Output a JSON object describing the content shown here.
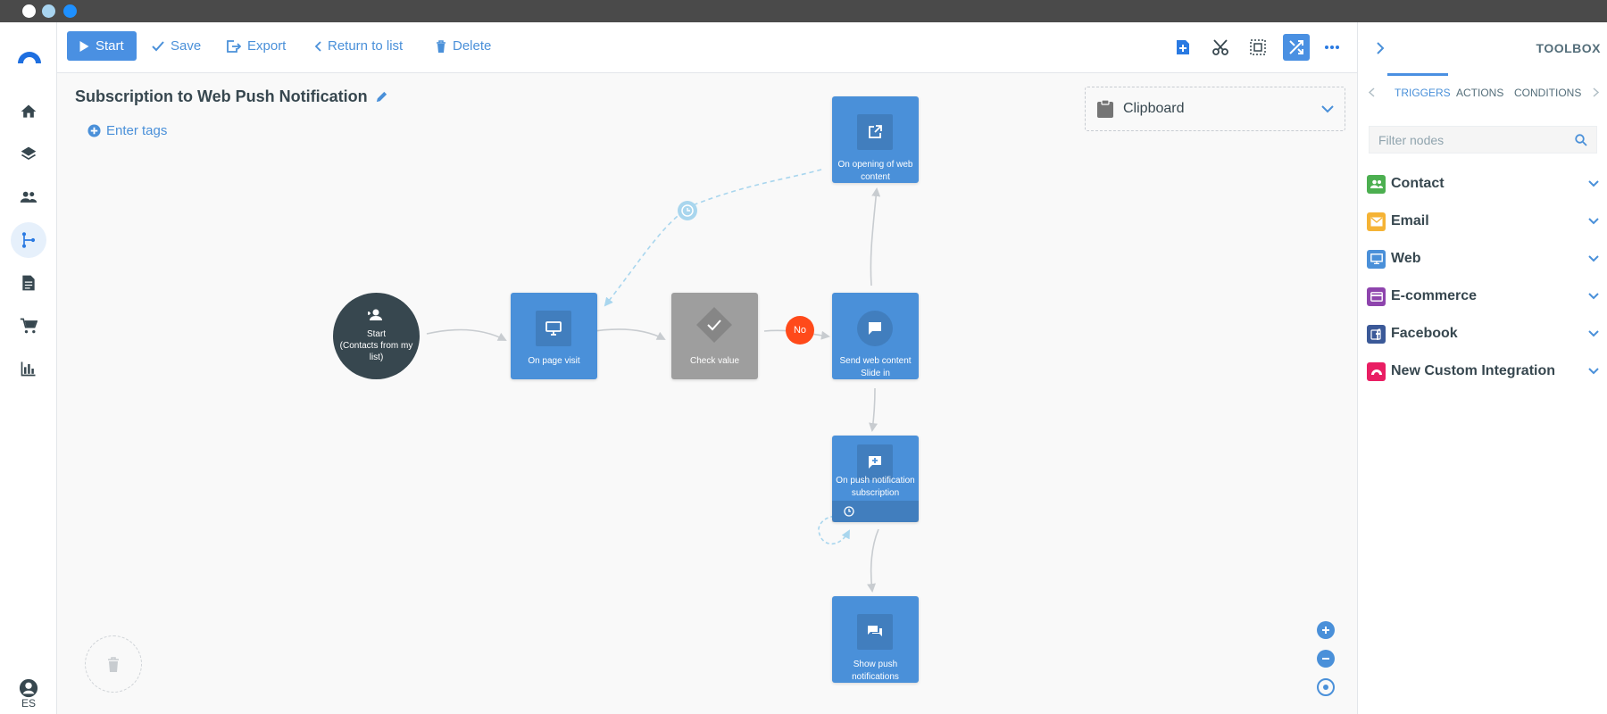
{
  "window": {
    "dots": [
      "#ffffff",
      "#a8d4f0",
      "#1e90ff"
    ]
  },
  "toolbar": {
    "start_label": "Start",
    "save_label": "Save",
    "export_label": "Export",
    "return_label": "Return to list",
    "delete_label": "Delete",
    "icons": [
      "add-note-icon",
      "scissors-icon",
      "select-icon",
      "shuffle-icon",
      "more-icon"
    ]
  },
  "rail": {
    "items": [
      "home",
      "layers",
      "contacts",
      "flows",
      "documents",
      "cart",
      "reports"
    ],
    "active": "flows",
    "lang": "ES"
  },
  "canvas": {
    "title": "Subscription to Web Push Notification",
    "tags_label": "Enter tags",
    "clipboard_label": "Clipboard",
    "nodes": {
      "start": {
        "line1": "Start",
        "line2": "(Contacts from my list)"
      },
      "page_visit": "On page visit",
      "check_value": "Check value",
      "no_badge": "No",
      "send_web": "Send web content Slide in",
      "open_web": "On opening of web content",
      "push_sub": "On push notification subscription",
      "show_push": "Show push notifications"
    }
  },
  "toolbox": {
    "title": "TOOLBOX",
    "tabs": [
      "TRIGGERS",
      "ACTIONS",
      "CONDITIONS"
    ],
    "active_tab": "TRIGGERS",
    "filter_placeholder": "Filter nodes",
    "categories": [
      {
        "label": "Contact",
        "color": "#4caf50"
      },
      {
        "label": "Email",
        "color": "#f5b335"
      },
      {
        "label": "Web",
        "color": "#4a90d9"
      },
      {
        "label": "E-commerce",
        "color": "#8e44ad"
      },
      {
        "label": "Facebook",
        "color": "#3b5998"
      },
      {
        "label": "New Custom Integration",
        "color": "#e91e63"
      }
    ]
  }
}
